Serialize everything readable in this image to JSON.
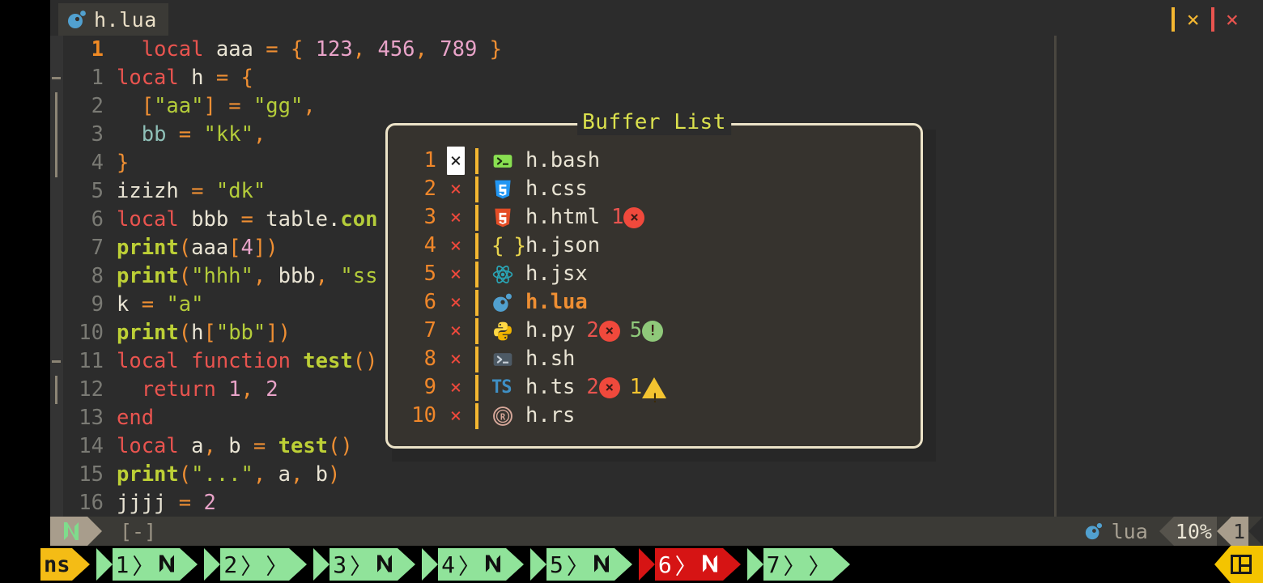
{
  "window": {
    "tab": {
      "label": "h.lua",
      "icon": "lua-icon"
    },
    "close_window_label": "×",
    "close_all_label": "×",
    "divider_colors": {
      "yellow": "#f4b731",
      "red": "#e9544f"
    }
  },
  "editor": {
    "cursor_line_number": "1",
    "lines": [
      {
        "num": "1",
        "current": true,
        "fold": "",
        "tokens": [
          {
            "t": "  ",
            "c": "id"
          },
          {
            "t": "local",
            "c": "kw"
          },
          {
            "t": " aaa ",
            "c": "id"
          },
          {
            "t": "=",
            "c": "op"
          },
          {
            "t": " ",
            "c": "id"
          },
          {
            "t": "{",
            "c": "op"
          },
          {
            "t": " ",
            "c": "id"
          },
          {
            "t": "123",
            "c": "num"
          },
          {
            "t": ",",
            "c": "op"
          },
          {
            "t": " ",
            "c": "id"
          },
          {
            "t": "456",
            "c": "num"
          },
          {
            "t": ",",
            "c": "op"
          },
          {
            "t": " ",
            "c": "id"
          },
          {
            "t": "789",
            "c": "num"
          },
          {
            "t": " ",
            "c": "id"
          },
          {
            "t": "}",
            "c": "op"
          }
        ]
      },
      {
        "num": "1",
        "current": false,
        "fold": "open",
        "tokens": [
          {
            "t": "local",
            "c": "kw"
          },
          {
            "t": " h ",
            "c": "id"
          },
          {
            "t": "=",
            "c": "op"
          },
          {
            "t": " ",
            "c": "id"
          },
          {
            "t": "{",
            "c": "op"
          }
        ]
      },
      {
        "num": "2",
        "current": false,
        "fold": "bar",
        "tokens": [
          {
            "t": "  ",
            "c": "id"
          },
          {
            "t": "[",
            "c": "op"
          },
          {
            "t": "\"aa\"",
            "c": "str"
          },
          {
            "t": "]",
            "c": "op"
          },
          {
            "t": " ",
            "c": "id"
          },
          {
            "t": "=",
            "c": "op"
          },
          {
            "t": " ",
            "c": "id"
          },
          {
            "t": "\"gg\"",
            "c": "str"
          },
          {
            "t": ",",
            "c": "op"
          }
        ]
      },
      {
        "num": "3",
        "current": false,
        "fold": "bar",
        "tokens": [
          {
            "t": "  ",
            "c": "id"
          },
          {
            "t": "bb",
            "c": "fld"
          },
          {
            "t": " ",
            "c": "id"
          },
          {
            "t": "=",
            "c": "op"
          },
          {
            "t": " ",
            "c": "id"
          },
          {
            "t": "\"kk\"",
            "c": "str"
          },
          {
            "t": ",",
            "c": "op"
          }
        ]
      },
      {
        "num": "4",
        "current": false,
        "fold": "bar",
        "tokens": [
          {
            "t": "}",
            "c": "op"
          }
        ]
      },
      {
        "num": "5",
        "current": false,
        "fold": "",
        "tokens": [
          {
            "t": "izizh ",
            "c": "id"
          },
          {
            "t": "=",
            "c": "op"
          },
          {
            "t": " ",
            "c": "id"
          },
          {
            "t": "\"dk\"",
            "c": "str"
          }
        ]
      },
      {
        "num": "6",
        "current": false,
        "fold": "",
        "tokens": [
          {
            "t": "local",
            "c": "kw"
          },
          {
            "t": " bbb ",
            "c": "id"
          },
          {
            "t": "=",
            "c": "op"
          },
          {
            "t": " table",
            "c": "id"
          },
          {
            "t": ".",
            "c": "id"
          },
          {
            "t": "con",
            "c": "prop"
          }
        ]
      },
      {
        "num": "7",
        "current": false,
        "fold": "",
        "tokens": [
          {
            "t": "print",
            "c": "fn"
          },
          {
            "t": "(",
            "c": "op"
          },
          {
            "t": "aaa",
            "c": "id"
          },
          {
            "t": "[",
            "c": "op"
          },
          {
            "t": "4",
            "c": "num"
          },
          {
            "t": "]",
            "c": "op"
          },
          {
            "t": ")",
            "c": "op"
          }
        ]
      },
      {
        "num": "8",
        "current": false,
        "fold": "",
        "tokens": [
          {
            "t": "print",
            "c": "fn"
          },
          {
            "t": "(",
            "c": "op"
          },
          {
            "t": "\"hhh\"",
            "c": "str"
          },
          {
            "t": ",",
            "c": "op"
          },
          {
            "t": " bbb",
            "c": "id"
          },
          {
            "t": ",",
            "c": "op"
          },
          {
            "t": " ",
            "c": "id"
          },
          {
            "t": "\"ss",
            "c": "str"
          }
        ]
      },
      {
        "num": "9",
        "current": false,
        "fold": "",
        "tokens": [
          {
            "t": "k ",
            "c": "id"
          },
          {
            "t": "=",
            "c": "op"
          },
          {
            "t": " ",
            "c": "id"
          },
          {
            "t": "\"a\"",
            "c": "str"
          }
        ]
      },
      {
        "num": "10",
        "current": false,
        "fold": "",
        "tokens": [
          {
            "t": "print",
            "c": "fn"
          },
          {
            "t": "(",
            "c": "op"
          },
          {
            "t": "h",
            "c": "id"
          },
          {
            "t": "[",
            "c": "op"
          },
          {
            "t": "\"bb\"",
            "c": "str"
          },
          {
            "t": "]",
            "c": "op"
          },
          {
            "t": ")",
            "c": "op"
          }
        ]
      },
      {
        "num": "11",
        "current": false,
        "fold": "open",
        "tokens": [
          {
            "t": "local function",
            "c": "kw"
          },
          {
            "t": " ",
            "c": "id"
          },
          {
            "t": "test",
            "c": "fn"
          },
          {
            "t": "()",
            "c": "op"
          }
        ]
      },
      {
        "num": "12",
        "current": false,
        "fold": "bar",
        "tokens": [
          {
            "t": "  ",
            "c": "id"
          },
          {
            "t": "return",
            "c": "kw"
          },
          {
            "t": " ",
            "c": "id"
          },
          {
            "t": "1",
            "c": "num"
          },
          {
            "t": ",",
            "c": "op"
          },
          {
            "t": " ",
            "c": "id"
          },
          {
            "t": "2",
            "c": "num"
          }
        ]
      },
      {
        "num": "13",
        "current": false,
        "fold": "",
        "tokens": [
          {
            "t": "end",
            "c": "kw"
          }
        ]
      },
      {
        "num": "14",
        "current": false,
        "fold": "",
        "tokens": [
          {
            "t": "local",
            "c": "kw"
          },
          {
            "t": " a",
            "c": "id"
          },
          {
            "t": ",",
            "c": "op"
          },
          {
            "t": " b ",
            "c": "id"
          },
          {
            "t": "=",
            "c": "op"
          },
          {
            "t": " ",
            "c": "id"
          },
          {
            "t": "test",
            "c": "fn"
          },
          {
            "t": "()",
            "c": "op"
          }
        ]
      },
      {
        "num": "15",
        "current": false,
        "fold": "",
        "tokens": [
          {
            "t": "print",
            "c": "fn"
          },
          {
            "t": "(",
            "c": "op"
          },
          {
            "t": "\"...\"",
            "c": "str"
          },
          {
            "t": ",",
            "c": "op"
          },
          {
            "t": " a",
            "c": "id"
          },
          {
            "t": ",",
            "c": "op"
          },
          {
            "t": " b",
            "c": "id"
          },
          {
            "t": ")",
            "c": "op"
          }
        ]
      },
      {
        "num": "16",
        "current": false,
        "fold": "",
        "tokens": [
          {
            "t": "jjjj ",
            "c": "id"
          },
          {
            "t": "=",
            "c": "op"
          },
          {
            "t": " ",
            "c": "id"
          },
          {
            "t": "2",
            "c": "num"
          }
        ]
      }
    ]
  },
  "popup": {
    "title": "Buffer List",
    "border_color": "#ece3c8",
    "buffers": [
      {
        "num": "1",
        "flag": "×",
        "cursor": true,
        "icon": "bash-icon",
        "name": "h.bash",
        "active": false,
        "diagnostics": []
      },
      {
        "num": "2",
        "flag": "×",
        "cursor": false,
        "icon": "css-icon",
        "name": "h.css",
        "active": false,
        "diagnostics": []
      },
      {
        "num": "3",
        "flag": "×",
        "cursor": false,
        "icon": "html-icon",
        "name": "h.html",
        "active": false,
        "diagnostics": [
          {
            "count": "1",
            "kind": "error"
          }
        ]
      },
      {
        "num": "4",
        "flag": "×",
        "cursor": false,
        "icon": "json-icon",
        "name": "h.json",
        "active": false,
        "diagnostics": []
      },
      {
        "num": "5",
        "flag": "×",
        "cursor": false,
        "icon": "react-icon",
        "name": "h.jsx",
        "active": false,
        "diagnostics": []
      },
      {
        "num": "6",
        "flag": "×",
        "cursor": false,
        "icon": "lua-icon",
        "name": "h.lua",
        "active": true,
        "diagnostics": []
      },
      {
        "num": "7",
        "flag": "×",
        "cursor": false,
        "icon": "python-icon",
        "name": "h.py",
        "active": false,
        "diagnostics": [
          {
            "count": "2",
            "kind": "error"
          },
          {
            "count": "5",
            "kind": "info"
          }
        ]
      },
      {
        "num": "8",
        "flag": "×",
        "cursor": false,
        "icon": "shell-icon",
        "name": "h.sh",
        "active": false,
        "diagnostics": []
      },
      {
        "num": "9",
        "flag": "×",
        "cursor": false,
        "icon": "ts-icon",
        "name": "h.ts",
        "active": false,
        "diagnostics": [
          {
            "count": "2",
            "kind": "error"
          },
          {
            "count": "1",
            "kind": "warn"
          }
        ]
      },
      {
        "num": "10",
        "flag": "×",
        "cursor": false,
        "icon": "rust-icon",
        "name": "h.rs",
        "active": false,
        "diagnostics": []
      }
    ]
  },
  "statusline": {
    "mode_icon": "neovim-icon",
    "filename": "[-]",
    "filetype_icon": "lua-icon",
    "filetype": "lua",
    "percent": "10%",
    "line": "1"
  },
  "bottom_tabline": {
    "label": "ns",
    "tabs": [
      {
        "label": "1",
        "glyph": "neovim-icon",
        "active": false
      },
      {
        "label": "2",
        "glyph": "chevrons",
        "active": false
      },
      {
        "label": "3",
        "glyph": "neovim-icon",
        "active": false
      },
      {
        "label": "4",
        "glyph": "neovim-icon",
        "active": false
      },
      {
        "label": "5",
        "glyph": "neovim-icon",
        "active": false
      },
      {
        "label": "6",
        "glyph": "neovim-icon",
        "active": true
      },
      {
        "label": "7",
        "glyph": "chevrons",
        "active": false
      }
    ],
    "layout_button": "layout-icon"
  }
}
